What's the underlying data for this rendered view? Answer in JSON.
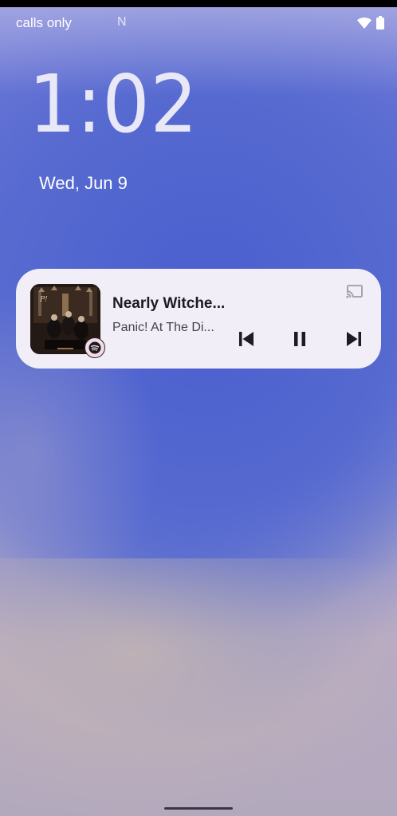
{
  "status_bar": {
    "carrier": "calls only",
    "notification_letter": "N",
    "icons": [
      "wifi-icon",
      "battery-icon"
    ]
  },
  "lockscreen": {
    "time": "1:02",
    "date": "Wed, Jun 9"
  },
  "media_player": {
    "title": "Nearly Witche...",
    "artist": "Panic! At The Di...",
    "app_icon": "spotify-icon",
    "controls": [
      "skip-previous-icon",
      "pause-icon",
      "skip-next-icon"
    ],
    "cast_icon": "cast-icon",
    "card_color": "#f1eef8"
  }
}
